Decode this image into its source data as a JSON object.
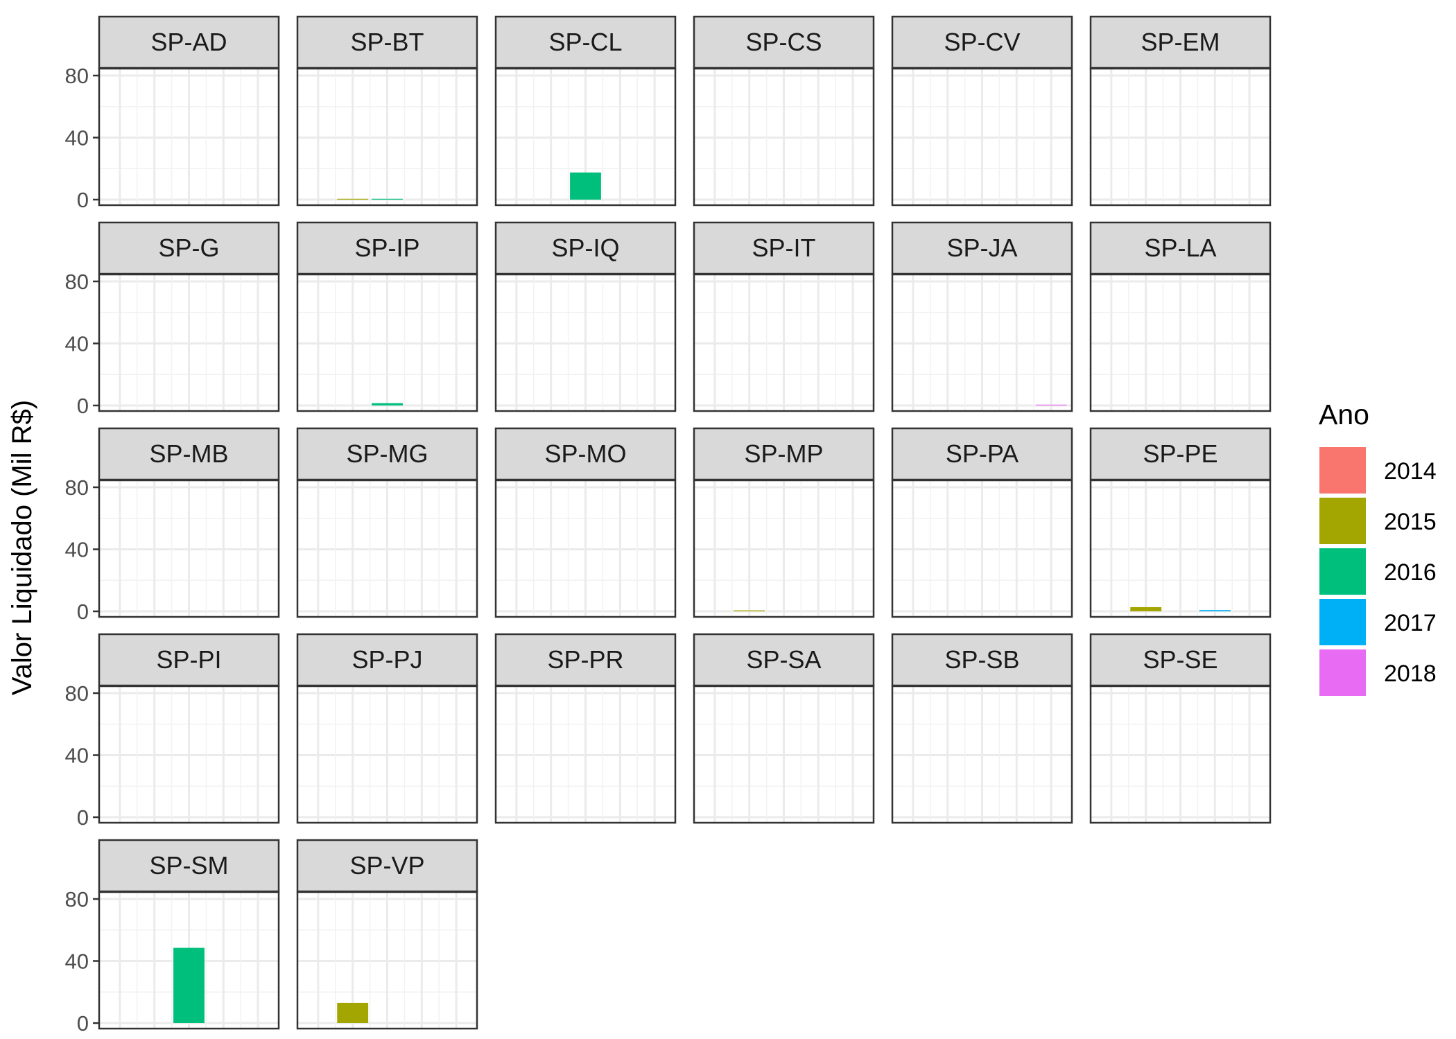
{
  "chart_data": {
    "type": "bar",
    "ylabel": "Valor Liquidado (Mil R$)",
    "xlabel": "",
    "ylim": [
      0,
      100
    ],
    "yticks": [
      0,
      40,
      80
    ],
    "facet_columns": 6,
    "legend": {
      "title": "Ano",
      "position": "right",
      "entries": [
        {
          "label": "2014",
          "color": "#F8766D"
        },
        {
          "label": "2015",
          "color": "#A3A500"
        },
        {
          "label": "2016",
          "color": "#00BF7D"
        },
        {
          "label": "2017",
          "color": "#00B0F6"
        },
        {
          "label": "2018",
          "color": "#E76BF3"
        }
      ]
    },
    "categories": [
      "2014",
      "2015",
      "2016",
      "2017",
      "2018"
    ],
    "facets": [
      {
        "label": "SP-AD",
        "values": [
          0,
          0,
          0,
          0,
          0
        ]
      },
      {
        "label": "SP-BT",
        "values": [
          0,
          0.5,
          0.4,
          0,
          0
        ]
      },
      {
        "label": "SP-CL",
        "values": [
          0,
          0,
          17.5,
          0,
          0
        ]
      },
      {
        "label": "SP-CS",
        "values": [
          0,
          0,
          0,
          0,
          0
        ]
      },
      {
        "label": "SP-CV",
        "values": [
          0,
          0,
          0,
          0,
          0
        ]
      },
      {
        "label": "SP-EM",
        "values": [
          0,
          0,
          0,
          0,
          0
        ]
      },
      {
        "label": "SP-G",
        "values": [
          0,
          0,
          0,
          0,
          0
        ]
      },
      {
        "label": "SP-IP",
        "values": [
          0,
          0,
          1.5,
          0,
          0
        ]
      },
      {
        "label": "SP-IQ",
        "values": [
          0,
          0,
          0,
          0,
          0
        ]
      },
      {
        "label": "SP-IT",
        "values": [
          0,
          0,
          0,
          0,
          0
        ]
      },
      {
        "label": "SP-JA",
        "values": [
          0,
          0,
          0,
          0,
          0.5
        ]
      },
      {
        "label": "SP-LA",
        "values": [
          0,
          0,
          0,
          0,
          0
        ]
      },
      {
        "label": "SP-MB",
        "values": [
          0,
          0,
          0,
          0,
          0
        ]
      },
      {
        "label": "SP-MG",
        "values": [
          0,
          0,
          0,
          0,
          0
        ]
      },
      {
        "label": "SP-MO",
        "values": [
          0,
          0,
          0,
          0,
          0
        ]
      },
      {
        "label": "SP-MP",
        "values": [
          0,
          0.6,
          0,
          0,
          0
        ]
      },
      {
        "label": "SP-PA",
        "values": [
          0,
          0,
          0,
          0,
          0
        ]
      },
      {
        "label": "SP-PE",
        "values": [
          0,
          2.7,
          0,
          0.8,
          0
        ]
      },
      {
        "label": "SP-PI",
        "values": [
          0,
          0,
          0,
          0,
          0
        ]
      },
      {
        "label": "SP-PJ",
        "values": [
          0,
          0,
          0,
          0,
          0
        ]
      },
      {
        "label": "SP-PR",
        "values": [
          0,
          0,
          0,
          0,
          0
        ]
      },
      {
        "label": "SP-SA",
        "values": [
          0,
          0,
          0,
          0,
          0
        ]
      },
      {
        "label": "SP-SB",
        "values": [
          0,
          0,
          0,
          0,
          0
        ]
      },
      {
        "label": "SP-SE",
        "values": [
          0,
          0,
          0,
          0,
          0
        ]
      },
      {
        "label": "SP-SM",
        "values": [
          0,
          0,
          48.5,
          0,
          0
        ]
      },
      {
        "label": "SP-VP",
        "values": [
          0,
          13,
          0,
          0,
          0
        ]
      }
    ]
  }
}
